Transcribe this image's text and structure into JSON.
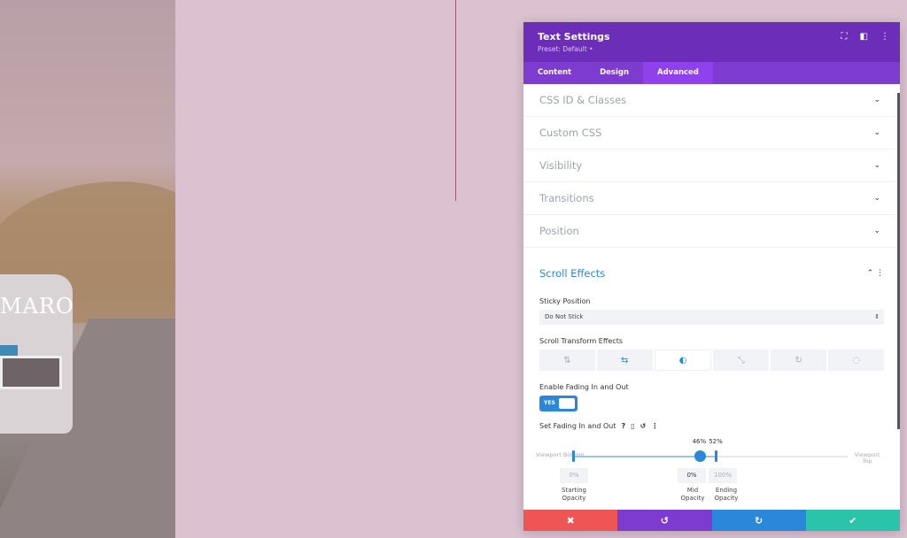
{
  "hero": {
    "title": "MARO"
  },
  "panel": {
    "title": "Text Settings",
    "preset": "Preset: Default •",
    "tabs": [
      {
        "label": "Content"
      },
      {
        "label": "Design"
      },
      {
        "label": "Advanced",
        "active": true
      }
    ],
    "sections": [
      {
        "label": "CSS ID & Classes"
      },
      {
        "label": "Custom CSS"
      },
      {
        "label": "Visibility"
      },
      {
        "label": "Transitions"
      },
      {
        "label": "Position"
      }
    ],
    "scroll_effects": {
      "title": "Scroll Effects",
      "sticky_label": "Sticky Position",
      "sticky_value": "Do Not Stick",
      "transform_label": "Scroll Transform Effects",
      "transform_icons": [
        "vertical-motion-icon",
        "horizontal-motion-icon",
        "fade-icon",
        "scale-icon",
        "rotate-icon",
        "blur-icon"
      ],
      "fading_label": "Enable Fading In and Out",
      "toggle": "YES",
      "set_fading_label": "Set Fading In and Out",
      "slider": {
        "bottom_label": "Viewport Bottom",
        "top_label": "Viewport Top",
        "start": 0,
        "mid": 46,
        "end": 52,
        "mid_pct": "46%",
        "end_pct": "52%",
        "starting_opacity": "0%",
        "mid_opacity": "0%",
        "ending_opacity": "100%",
        "starting_label": "Starting Opacity",
        "mid_label": "Mid Opacity",
        "ending_label": "Ending Opacity"
      }
    },
    "footer_colors": {
      "cancel": "#ef5555",
      "undo": "#7e3bd0",
      "redo": "#2b87da",
      "save": "#29c4a9"
    }
  }
}
